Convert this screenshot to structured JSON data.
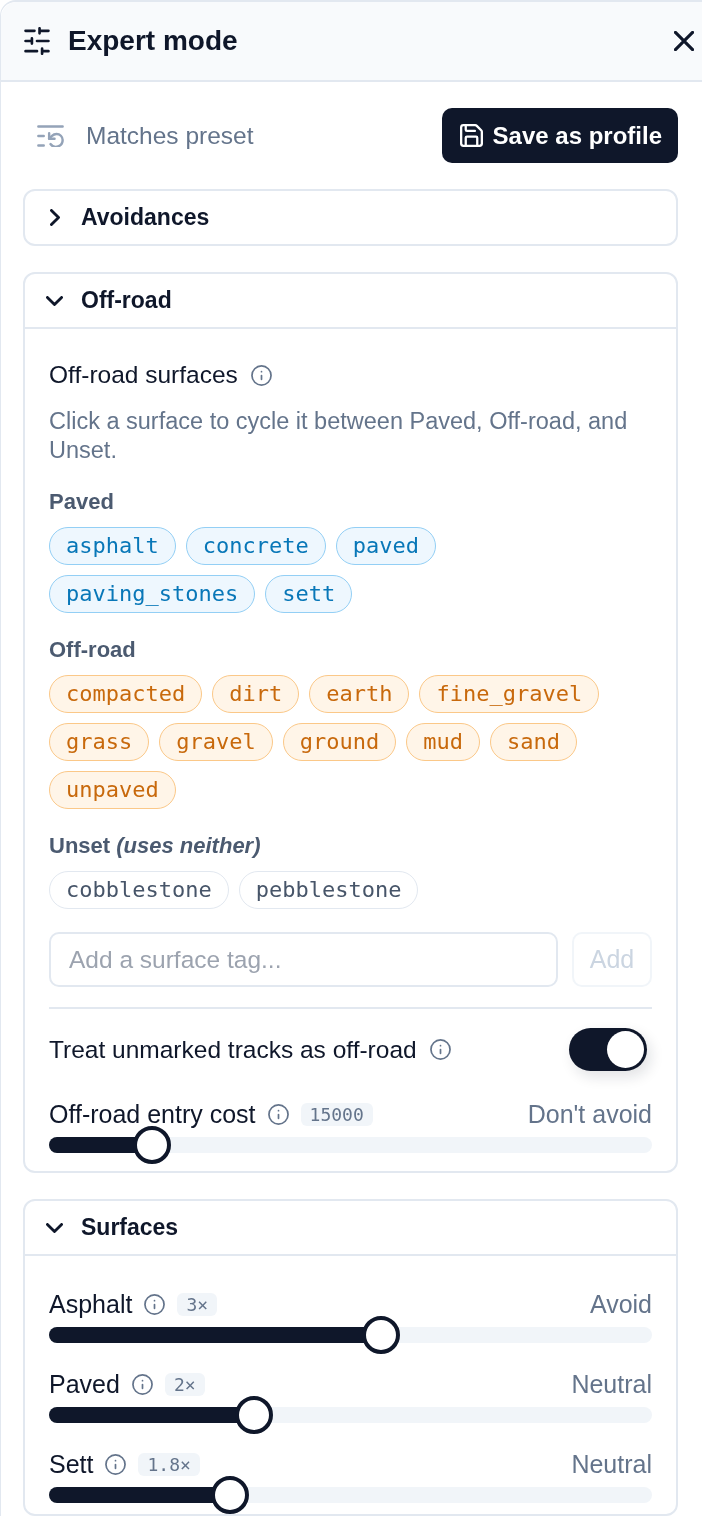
{
  "header": {
    "title": "Expert mode"
  },
  "toolbar": {
    "status": "Matches preset",
    "save_button": "Save as profile"
  },
  "sections": [
    {
      "title": "Avoidances",
      "expanded": false
    },
    {
      "title": "Off-road",
      "expanded": true,
      "kind": "surface_editor",
      "surfaces": {
        "title": "Off-road surfaces",
        "description": "Click a surface to cycle it between Paved, Off-road, and Unset.",
        "groups": [
          {
            "label": "Paved",
            "kind": "paved",
            "tags": [
              "asphalt",
              "concrete",
              "paved",
              "paving_stones",
              "sett"
            ]
          },
          {
            "label": "Off-road",
            "kind": "offroad",
            "tags": [
              "compacted",
              "dirt",
              "earth",
              "fine_gravel",
              "grass",
              "gravel",
              "ground",
              "mud",
              "sand",
              "unpaved"
            ]
          },
          {
            "label": "Unset *(uses neither)*",
            "kind": "unset",
            "tags": [
              "cobblestone",
              "pebblestone"
            ]
          }
        ],
        "input": {
          "placeholder": "Add a surface tag..."
        },
        "add_button": {
          "label": "Add",
          "disabled": true
        }
      },
      "toggle": {
        "label": "Treat unmarked tracks as off-road",
        "on": true
      },
      "slider": {
        "label": "Off-road entry cost",
        "badge": "15000",
        "reading": "Don't avoid",
        "level": 0.17
      }
    },
    {
      "title": "Surfaces",
      "expanded": true,
      "kind": "slider_list",
      "sliders": [
        {
          "label": "Asphalt",
          "badge": "3×",
          "reading": "Avoid",
          "level": 0.55
        },
        {
          "label": "Paved",
          "badge": "2×",
          "reading": "Neutral",
          "level": 0.34
        },
        {
          "label": "Sett",
          "badge": "1.8×",
          "reading": "Neutral",
          "level": 0.3
        }
      ]
    }
  ]
}
